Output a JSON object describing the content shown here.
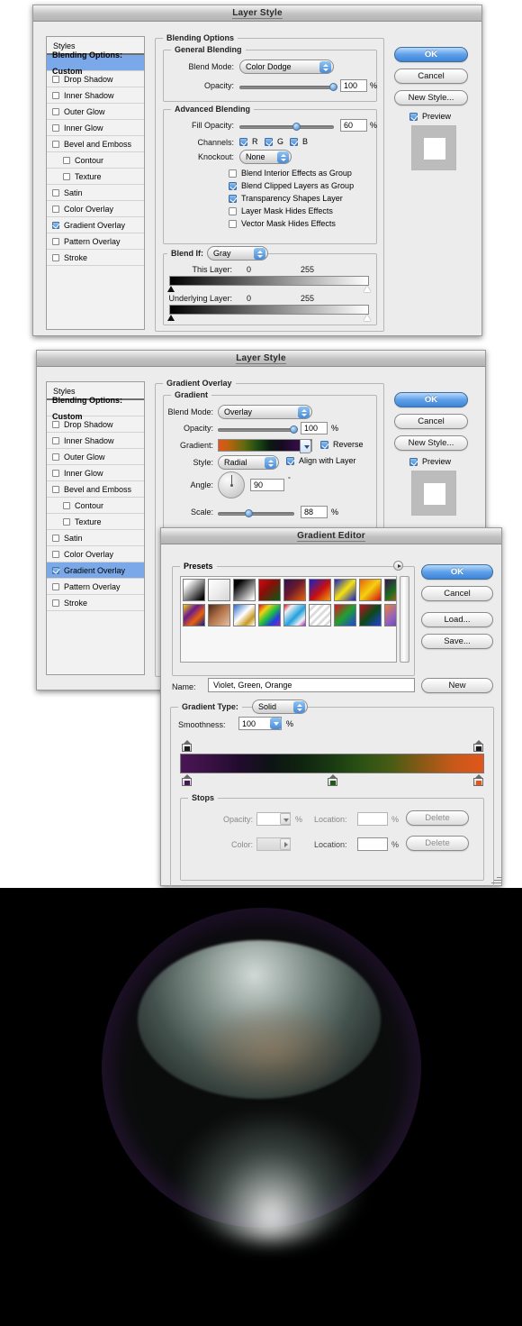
{
  "dialog1": {
    "title": "Layer Style",
    "styles_header": "Styles",
    "styles_items": [
      {
        "label": "Blending Options: Custom",
        "checkbox": false,
        "checked": false,
        "selected": true,
        "indent": false
      },
      {
        "label": "Drop Shadow",
        "checkbox": true,
        "checked": false,
        "selected": false,
        "indent": false
      },
      {
        "label": "Inner Shadow",
        "checkbox": true,
        "checked": false,
        "selected": false,
        "indent": false
      },
      {
        "label": "Outer Glow",
        "checkbox": true,
        "checked": false,
        "selected": false,
        "indent": false
      },
      {
        "label": "Inner Glow",
        "checkbox": true,
        "checked": false,
        "selected": false,
        "indent": false
      },
      {
        "label": "Bevel and Emboss",
        "checkbox": true,
        "checked": false,
        "selected": false,
        "indent": false
      },
      {
        "label": "Contour",
        "checkbox": true,
        "checked": false,
        "selected": false,
        "indent": true
      },
      {
        "label": "Texture",
        "checkbox": true,
        "checked": false,
        "selected": false,
        "indent": true
      },
      {
        "label": "Satin",
        "checkbox": true,
        "checked": false,
        "selected": false,
        "indent": false
      },
      {
        "label": "Color Overlay",
        "checkbox": true,
        "checked": false,
        "selected": false,
        "indent": false
      },
      {
        "label": "Gradient Overlay",
        "checkbox": true,
        "checked": true,
        "selected": false,
        "indent": false
      },
      {
        "label": "Pattern Overlay",
        "checkbox": true,
        "checked": false,
        "selected": false,
        "indent": false
      },
      {
        "label": "Stroke",
        "checkbox": true,
        "checked": false,
        "selected": false,
        "indent": false
      }
    ],
    "group_blending_options": "Blending Options",
    "group_general_blending": "General Blending",
    "blend_mode_label": "Blend Mode:",
    "blend_mode_value": "Color Dodge",
    "opacity_label": "Opacity:",
    "opacity_value": "100",
    "opacity_pct": "%",
    "group_advanced_blending": "Advanced Blending",
    "fill_opacity_label": "Fill Opacity:",
    "fill_opacity_value": "60",
    "fill_opacity_pct": "%",
    "channels_label": "Channels:",
    "channel_r": "R",
    "channel_g": "G",
    "channel_b": "B",
    "knockout_label": "Knockout:",
    "knockout_value": "None",
    "advanced_checks": [
      {
        "label": "Blend Interior Effects as Group",
        "checked": false
      },
      {
        "label": "Blend Clipped Layers as Group",
        "checked": true
      },
      {
        "label": "Transparency Shapes Layer",
        "checked": true
      },
      {
        "label": "Layer Mask Hides Effects",
        "checked": false
      },
      {
        "label": "Vector Mask Hides Effects",
        "checked": false
      }
    ],
    "blend_if_label": "Blend If:",
    "blend_if_value": "Gray",
    "this_layer_label": "This Layer:",
    "this_layer_min": "0",
    "this_layer_max": "255",
    "underlying_layer_label": "Underlying Layer:",
    "underlying_layer_min": "0",
    "underlying_layer_max": "255",
    "ok_label": "OK",
    "cancel_label": "Cancel",
    "new_style_label": "New Style...",
    "preview_label": "Preview",
    "preview_checked": true
  },
  "dialog2": {
    "title": "Layer Style",
    "styles_header": "Styles",
    "styles_items": [
      {
        "label": "Blending Options: Custom",
        "checkbox": false,
        "checked": false,
        "selected": false,
        "indent": false
      },
      {
        "label": "Drop Shadow",
        "checkbox": true,
        "checked": false,
        "selected": false,
        "indent": false
      },
      {
        "label": "Inner Shadow",
        "checkbox": true,
        "checked": false,
        "selected": false,
        "indent": false
      },
      {
        "label": "Outer Glow",
        "checkbox": true,
        "checked": false,
        "selected": false,
        "indent": false
      },
      {
        "label": "Inner Glow",
        "checkbox": true,
        "checked": false,
        "selected": false,
        "indent": false
      },
      {
        "label": "Bevel and Emboss",
        "checkbox": true,
        "checked": false,
        "selected": false,
        "indent": false
      },
      {
        "label": "Contour",
        "checkbox": true,
        "checked": false,
        "selected": false,
        "indent": true
      },
      {
        "label": "Texture",
        "checkbox": true,
        "checked": false,
        "selected": false,
        "indent": true
      },
      {
        "label": "Satin",
        "checkbox": true,
        "checked": false,
        "selected": false,
        "indent": false
      },
      {
        "label": "Color Overlay",
        "checkbox": true,
        "checked": false,
        "selected": false,
        "indent": false
      },
      {
        "label": "Gradient Overlay",
        "checkbox": true,
        "checked": true,
        "selected": true,
        "indent": false
      },
      {
        "label": "Pattern Overlay",
        "checkbox": true,
        "checked": false,
        "selected": false,
        "indent": false
      },
      {
        "label": "Stroke",
        "checkbox": true,
        "checked": false,
        "selected": false,
        "indent": false
      }
    ],
    "group_gradient_overlay": "Gradient Overlay",
    "group_gradient": "Gradient",
    "blend_mode_label": "Blend Mode:",
    "blend_mode_value": "Overlay",
    "opacity_label": "Opacity:",
    "opacity_value": "100",
    "opacity_pct": "%",
    "gradient_label": "Gradient:",
    "reverse_label": "Reverse",
    "reverse_checked": true,
    "style_label": "Style:",
    "style_value": "Radial",
    "align_label": "Align with Layer",
    "align_checked": true,
    "angle_label": "Angle:",
    "angle_value": "90",
    "angle_unit": "°",
    "scale_label": "Scale:",
    "scale_value": "88",
    "scale_pct": "%",
    "ok_label": "OK",
    "cancel_label": "Cancel",
    "new_style_label": "New Style...",
    "preview_label": "Preview",
    "preview_checked": true
  },
  "gradient_editor": {
    "title": "Gradient Editor",
    "presets_label": "Presets",
    "preset_swatches": [
      {
        "name": "foreground-to-background",
        "css": "linear-gradient(135deg,#ffffff 0%,#ffffff 18%,#000000 92%)"
      },
      {
        "name": "foreground-to-transparent",
        "css": "linear-gradient(135deg,#ffffff 0%,#e6e6e6 55%,#d4d4d4 100%)"
      },
      {
        "name": "black-white",
        "css": "linear-gradient(135deg,#000000 0%,#000000 20%,#ffffff 95%)"
      },
      {
        "name": "red-green",
        "css": "linear-gradient(135deg,#cf0a12 0%,#8a0d0a 40%,#0a5a10 100%)"
      },
      {
        "name": "violet-orange",
        "css": "linear-gradient(135deg,#2a1150 0%,#6b1a2c 45%,#e8620c 100%)"
      },
      {
        "name": "blue-red-yellow",
        "css": "linear-gradient(135deg,#1420c8 0%,#c81010 55%,#f0a010 100%)"
      },
      {
        "name": "blue-yellow-blue",
        "css": "linear-gradient(135deg,#1420c8 0%,#f5e210 50%,#1420c8 100%)"
      },
      {
        "name": "orange-yellow-orange",
        "css": "linear-gradient(135deg,#e8620c 0%,#f5d010 50%,#d01010 100%)"
      },
      {
        "name": "violet-green-orange",
        "css": "linear-gradient(135deg,#3c1050 0%,#1a6a20 45%,#e8620c 100%)"
      },
      {
        "name": "yellow-violet-orange-blue",
        "css": "linear-gradient(135deg,#f0d010 0%,#6b1a8c 35%,#e8620c 65%,#101a8c 100%)"
      },
      {
        "name": "copper",
        "css": "linear-gradient(135deg,#4a2a18 0%,#b07048 45%,#e8c0a0 100%)"
      },
      {
        "name": "chrome",
        "css": "linear-gradient(135deg,#2a6ac8 0%,#ffffff 45%,#c89820 75%,#ffffff 100%)"
      },
      {
        "name": "spectrum",
        "css": "linear-gradient(135deg,#e01020 0%,#f0d010 25%,#20c040 50%,#2040e0 75%,#a020c0 100%)"
      },
      {
        "name": "transparent-rainbow",
        "css": "linear-gradient(135deg,#e01020 0%,#f0f0f0 20%,#20a0e0 55%,#f0f0f0 80%,#a020c0 100%)"
      },
      {
        "name": "transparent-stripes",
        "css": "linear-gradient(135deg,#f2f2f2 0%,#d8d8d8 50%,#f2f2f2 100%)"
      },
      {
        "name": "red-green-blue",
        "css": "linear-gradient(135deg,#e01020 0%,#20a030 50%,#2040e0 100%)"
      },
      {
        "name": "dark-red-green-blue",
        "css": "linear-gradient(135deg,#c01020 0%,#0a4a18 50%,#2040e0 100%)"
      },
      {
        "name": "orange-violet",
        "css": "linear-gradient(135deg,#e8823c 0%,#9060c0 50%,#6030a0 100%)"
      }
    ],
    "name_label": "Name:",
    "name_value": "Violet, Green, Orange",
    "new_label": "New",
    "ok_label": "OK",
    "cancel_label": "Cancel",
    "load_label": "Load...",
    "save_label": "Save...",
    "gradient_type_label": "Gradient Type:",
    "gradient_type_value": "Solid",
    "smoothness_label": "Smoothness:",
    "smoothness_value": "100",
    "smoothness_pct": "%",
    "color_stops": [
      {
        "color": "#4a1655",
        "location": 0
      },
      {
        "color": "#1a5a16",
        "location": 50
      },
      {
        "color": "#e2561a",
        "location": 100
      }
    ],
    "opacity_stops": [
      {
        "location": 0
      },
      {
        "location": 100
      }
    ],
    "stops_group_label": "Stops",
    "stops_opacity_label": "Opacity:",
    "stops_opacity_value": "",
    "stops_opacity_pct": "%",
    "stops_color_label": "Color:",
    "stops_location_label_1": "Location:",
    "stops_location_value_1": "",
    "stops_location_pct_1": "%",
    "stops_location_label_2": "Location:",
    "stops_location_value_2": "",
    "stops_location_pct_2": "%",
    "delete_label_1": "Delete",
    "delete_label_2": "Delete"
  },
  "artwork": {
    "description": "Rendered sphere with gradient overlay on black background",
    "background_color": "#000000",
    "sphere_rim_color": "#5a2f78",
    "sphere_highlight_color": "#dde7e3",
    "sphere_warm_color": "#b07c4e"
  }
}
